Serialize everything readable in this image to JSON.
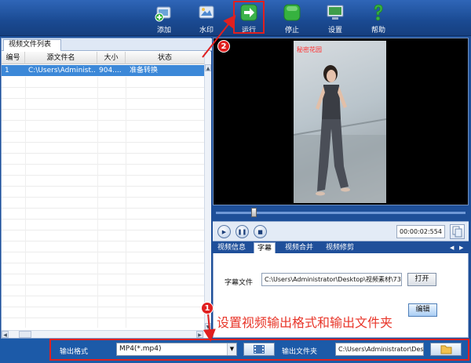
{
  "toolbar": {
    "buttons": [
      {
        "label": "添加",
        "icon": "add-icon"
      },
      {
        "label": "水印",
        "icon": "watermark-icon"
      },
      {
        "label": "运行",
        "icon": "run-arrow-icon"
      },
      {
        "label": "停止",
        "icon": "stop-icon"
      },
      {
        "label": "设置",
        "icon": "settings-icon"
      },
      {
        "label": "帮助",
        "icon": "help-icon"
      }
    ]
  },
  "file_list": {
    "tab_label": "视频文件列表",
    "columns": [
      "编号",
      "源文件名",
      "大小",
      "状态"
    ],
    "rows": [
      {
        "index": "1",
        "name": "C:\\Users\\Administ...",
        "size": "904....",
        "status": "准备转换"
      }
    ]
  },
  "preview": {
    "watermark_text": "秘密花园"
  },
  "player": {
    "time": "00:00:02:554",
    "progress": 0.15
  },
  "tabs": {
    "items": [
      "视频信息",
      "字幕",
      "视频合并",
      "视频修剪"
    ],
    "active": "字幕"
  },
  "subtitle": {
    "label": "字幕文件",
    "path": "C:\\Users\\Administrator\\Desktop\\视频素材\\731b",
    "open_button": "打开",
    "edit_button": "编辑"
  },
  "annotations": {
    "marker1": "1",
    "marker2": "2",
    "caption": "设置视频输出格式和输出文件夹"
  },
  "output": {
    "format_label": "输出格式",
    "format_value": "MP4(*.mp4)",
    "folder_label": "输出文件夹",
    "folder_value": "C:\\Users\\Administrator\\Des"
  },
  "colors": {
    "accent_blue": "#1c5aa8",
    "highlight_red": "#e02020",
    "selection_blue": "#3c88d8"
  }
}
